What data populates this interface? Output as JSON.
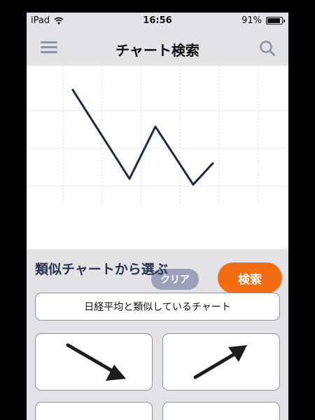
{
  "status_bar": {
    "device": "iPad",
    "time": "16:56",
    "battery": "91%",
    "battery_level": 0.91,
    "wifi_icon": "wifi-icon"
  },
  "nav": {
    "title": "チャート検索",
    "menu_icon": "hamburger-menu-icon",
    "search_icon": "search-icon"
  },
  "chart_data": {
    "type": "line",
    "title": "",
    "xlabel": "",
    "ylabel": "",
    "x": [
      0,
      1,
      2,
      3,
      4
    ],
    "values": [
      100,
      8,
      62,
      2,
      24
    ],
    "ylim": [
      -20,
      125
    ],
    "grid": true,
    "line_color": "#1f2a3d"
  },
  "actions": {
    "clear_label": "クリア",
    "search_label": "検索"
  },
  "similar": {
    "section_title": "類似チャートから選ぶ",
    "nikkei_label": "日経平均と類似しているチャート",
    "cards": [
      {
        "icon": "down-right-arrow-icon"
      },
      {
        "icon": "up-right-arrow-icon"
      }
    ]
  },
  "colors": {
    "accent": "#f26c12",
    "clear_button": "#9aa1b8",
    "section_title": "#2a3450"
  }
}
